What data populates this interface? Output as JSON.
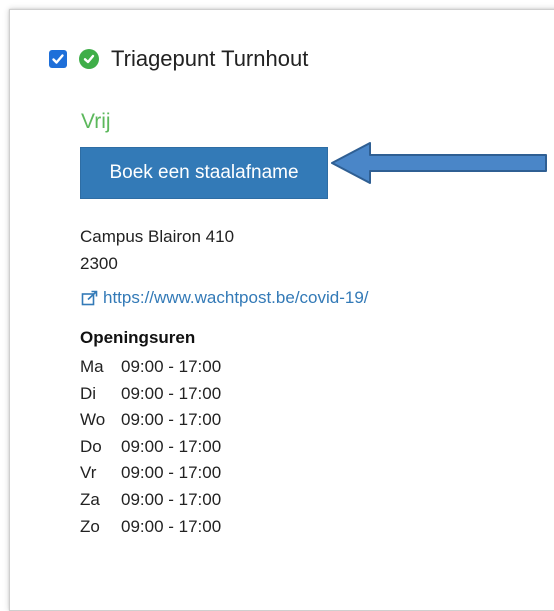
{
  "location": {
    "name": "Triagepunt Turnhout",
    "checked": true,
    "status": "Vrij",
    "status_color": "#5cb85c",
    "status_icon": "check-circle-icon",
    "book_button_label": "Boek een staalafname",
    "button_color": "#337ab7",
    "address_line1": "Campus Blairon 410",
    "address_line2": "2300",
    "website": "https://www.wachtpost.be/covid-19/",
    "website_icon": "external-link-icon",
    "hours_title": "Openingsuren",
    "hours": [
      {
        "day": "Ma",
        "time": "09:00 - 17:00"
      },
      {
        "day": "Di",
        "time": "09:00 - 17:00"
      },
      {
        "day": "Wo",
        "time": "09:00 - 17:00"
      },
      {
        "day": "Do",
        "time": "09:00 - 17:00"
      },
      {
        "day": "Vr",
        "time": "09:00 - 17:00"
      },
      {
        "day": "Za",
        "time": "09:00 - 17:00"
      },
      {
        "day": "Zo",
        "time": "09:00 - 17:00"
      }
    ]
  },
  "annotation": {
    "arrow_color": "#4a86c8",
    "arrow_icon": "left-arrow-annotation"
  }
}
